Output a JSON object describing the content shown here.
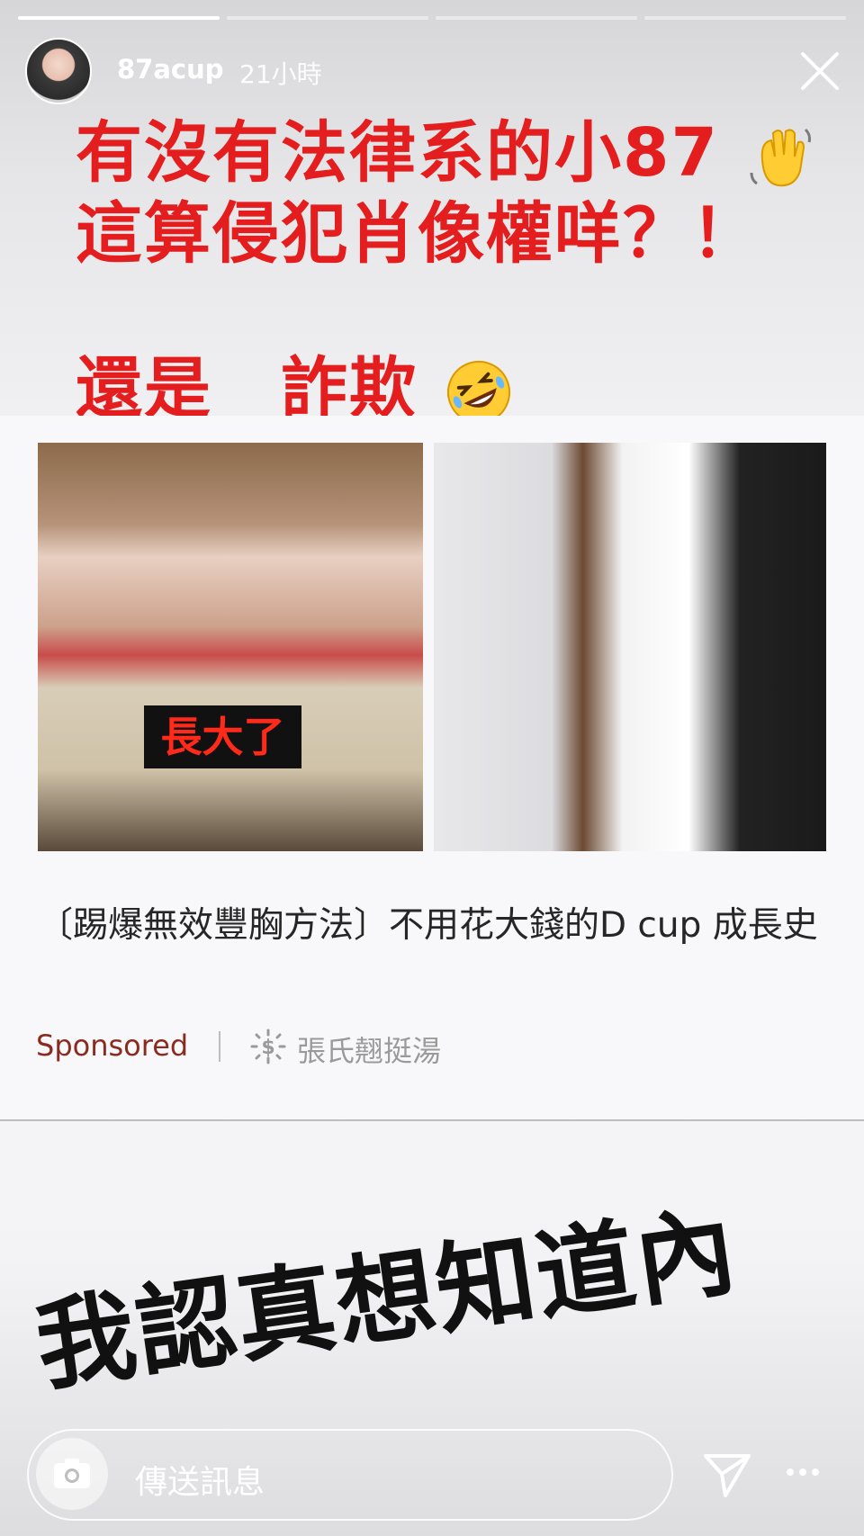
{
  "progress": [
    1,
    0,
    0,
    0
  ],
  "header": {
    "username": "87acup",
    "time": "21小時"
  },
  "caption": {
    "line1": "有沒有法律系的小87",
    "line2": "這算侵犯肖像權咩？！",
    "line3": "還是　詐欺"
  },
  "ad": {
    "badge": "長大了",
    "title": "〔踢爆無效豐胸方法〕不用花大錢的D cup 成長史",
    "sponsored": "Sponsored",
    "advertiser": "張氏翹挺湯"
  },
  "handwritten": "我認真想知道內",
  "reply": {
    "placeholder": "傳送訊息"
  },
  "icons": {
    "close": "close-icon",
    "camera": "camera-icon",
    "send": "send-icon",
    "more": "more-icon",
    "wave": "waving-hand-icon",
    "laugh": "rofl-emoji-icon",
    "dollar": "dollar-sign-icon"
  },
  "colors": {
    "caption_red": "#e41e1e",
    "sponsored": "#8b2a1e"
  }
}
